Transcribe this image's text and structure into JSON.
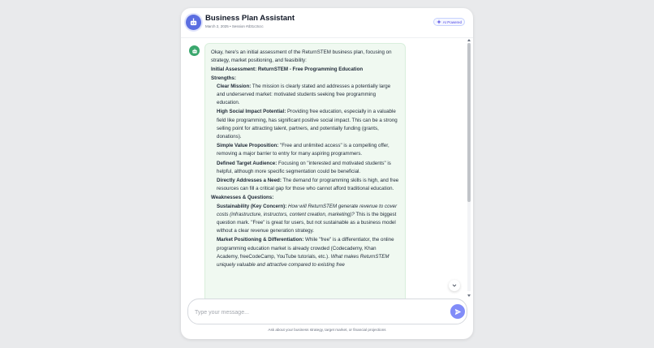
{
  "header": {
    "title": "Business Plan Assistant",
    "subtitle": "March 2, 2025 • Session #d31c3ccc",
    "badge": "AI Powered"
  },
  "message": {
    "intro": "Okay, here's an initial assessment of the ReturnSTEM business plan, focusing on strategy, market positioning, and feasibility:",
    "heading": "Initial Assessment: ReturnSTEM - Free Programming Education",
    "strengths_label": "Strengths:",
    "strengths": [
      {
        "title": "Clear Mission:",
        "text": "The mission is clearly stated and addresses a potentially large and underserved market: motivated students seeking free programming education."
      },
      {
        "title": "High Social Impact Potential:",
        "text": "Providing free education, especially in a valuable field like programming, has significant positive social impact. This can be a strong selling point for attracting talent, partners, and potentially funding (grants, donations)."
      },
      {
        "title": "Simple Value Proposition:",
        "text": "\"Free and unlimited access\" is a compelling offer, removing a major barrier to entry for many aspiring programmers."
      },
      {
        "title": "Defined Target Audience:",
        "text": "Focusing on \"interested and motivated students\" is helpful, although more specific segmentation could be beneficial."
      },
      {
        "title": "Directly Addresses a Need:",
        "text": "The demand for programming skills is high, and free resources can fill a critical gap for those who cannot afford traditional education."
      }
    ],
    "weaknesses_label": "Weaknesses & Questions:",
    "weaknesses": [
      {
        "title": "Sustainability (Key Concern):",
        "italic": "How will ReturnSTEM generate revenue to cover costs (infrastructure, instructors, content creation, marketing)?",
        "text": "This is the biggest question mark. \"Free\" is great for users, but not sustainable as a business model without a clear revenue generation strategy."
      },
      {
        "title": "Market Positioning & Differentiation:",
        "text": "While \"free\" is a differentiator, the online programming education market is already crowded (Codecademy, Khan Academy, freeCodeCamp, YouTube tutorials, etc.).",
        "italic": "What makes ReturnSTEM uniquely valuable and attractive compared to existing free"
      }
    ]
  },
  "composer": {
    "placeholder": "Type your message..."
  },
  "footer_hint": "Ask about your business strategy, target market, or financial projections",
  "icons": {
    "logo": "robot-icon",
    "badge": "sparkle-icon",
    "avatar": "robot-icon",
    "jump": "chevron-down-icon",
    "send": "send-icon"
  },
  "colors": {
    "accent": "#5b6ee1",
    "bot_bubble": "#f0f9f1",
    "bot_avatar": "#3aa76d",
    "send_button": "#818cf8"
  }
}
